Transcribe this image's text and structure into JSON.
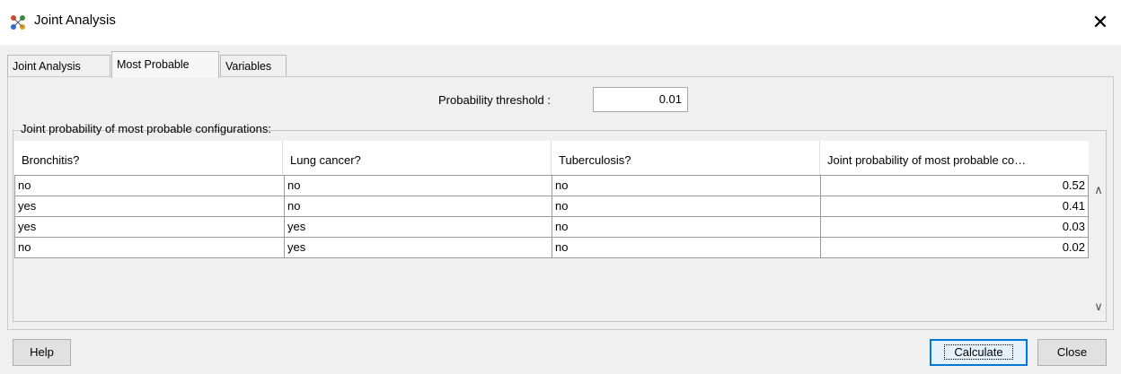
{
  "window": {
    "title": "Joint Analysis",
    "icon": "network-nodes-icon",
    "close_glyph": "✕"
  },
  "tabs": [
    {
      "label": "Joint Analysis",
      "active": false
    },
    {
      "label": "Most Probable",
      "active": true
    },
    {
      "label": "Variables",
      "active": false
    }
  ],
  "threshold": {
    "label": "Probability threshold :",
    "value": "0.01"
  },
  "group_label": "Joint probability of most probable configurations:",
  "table": {
    "columns": [
      "Bronchitis?",
      "Lung cancer?",
      "Tuberculosis?",
      "Joint probability of most probable co…"
    ],
    "rows": [
      [
        "no",
        "no",
        "no",
        "0.52"
      ],
      [
        "yes",
        "no",
        "no",
        "0.41"
      ],
      [
        "yes",
        "yes",
        "no",
        "0.03"
      ],
      [
        "no",
        "yes",
        "no",
        "0.02"
      ]
    ]
  },
  "scrollbar": {
    "up_glyph": "∧",
    "down_glyph": "∨"
  },
  "buttons": {
    "help": "Help",
    "calculate": "Calculate",
    "close": "Close"
  }
}
